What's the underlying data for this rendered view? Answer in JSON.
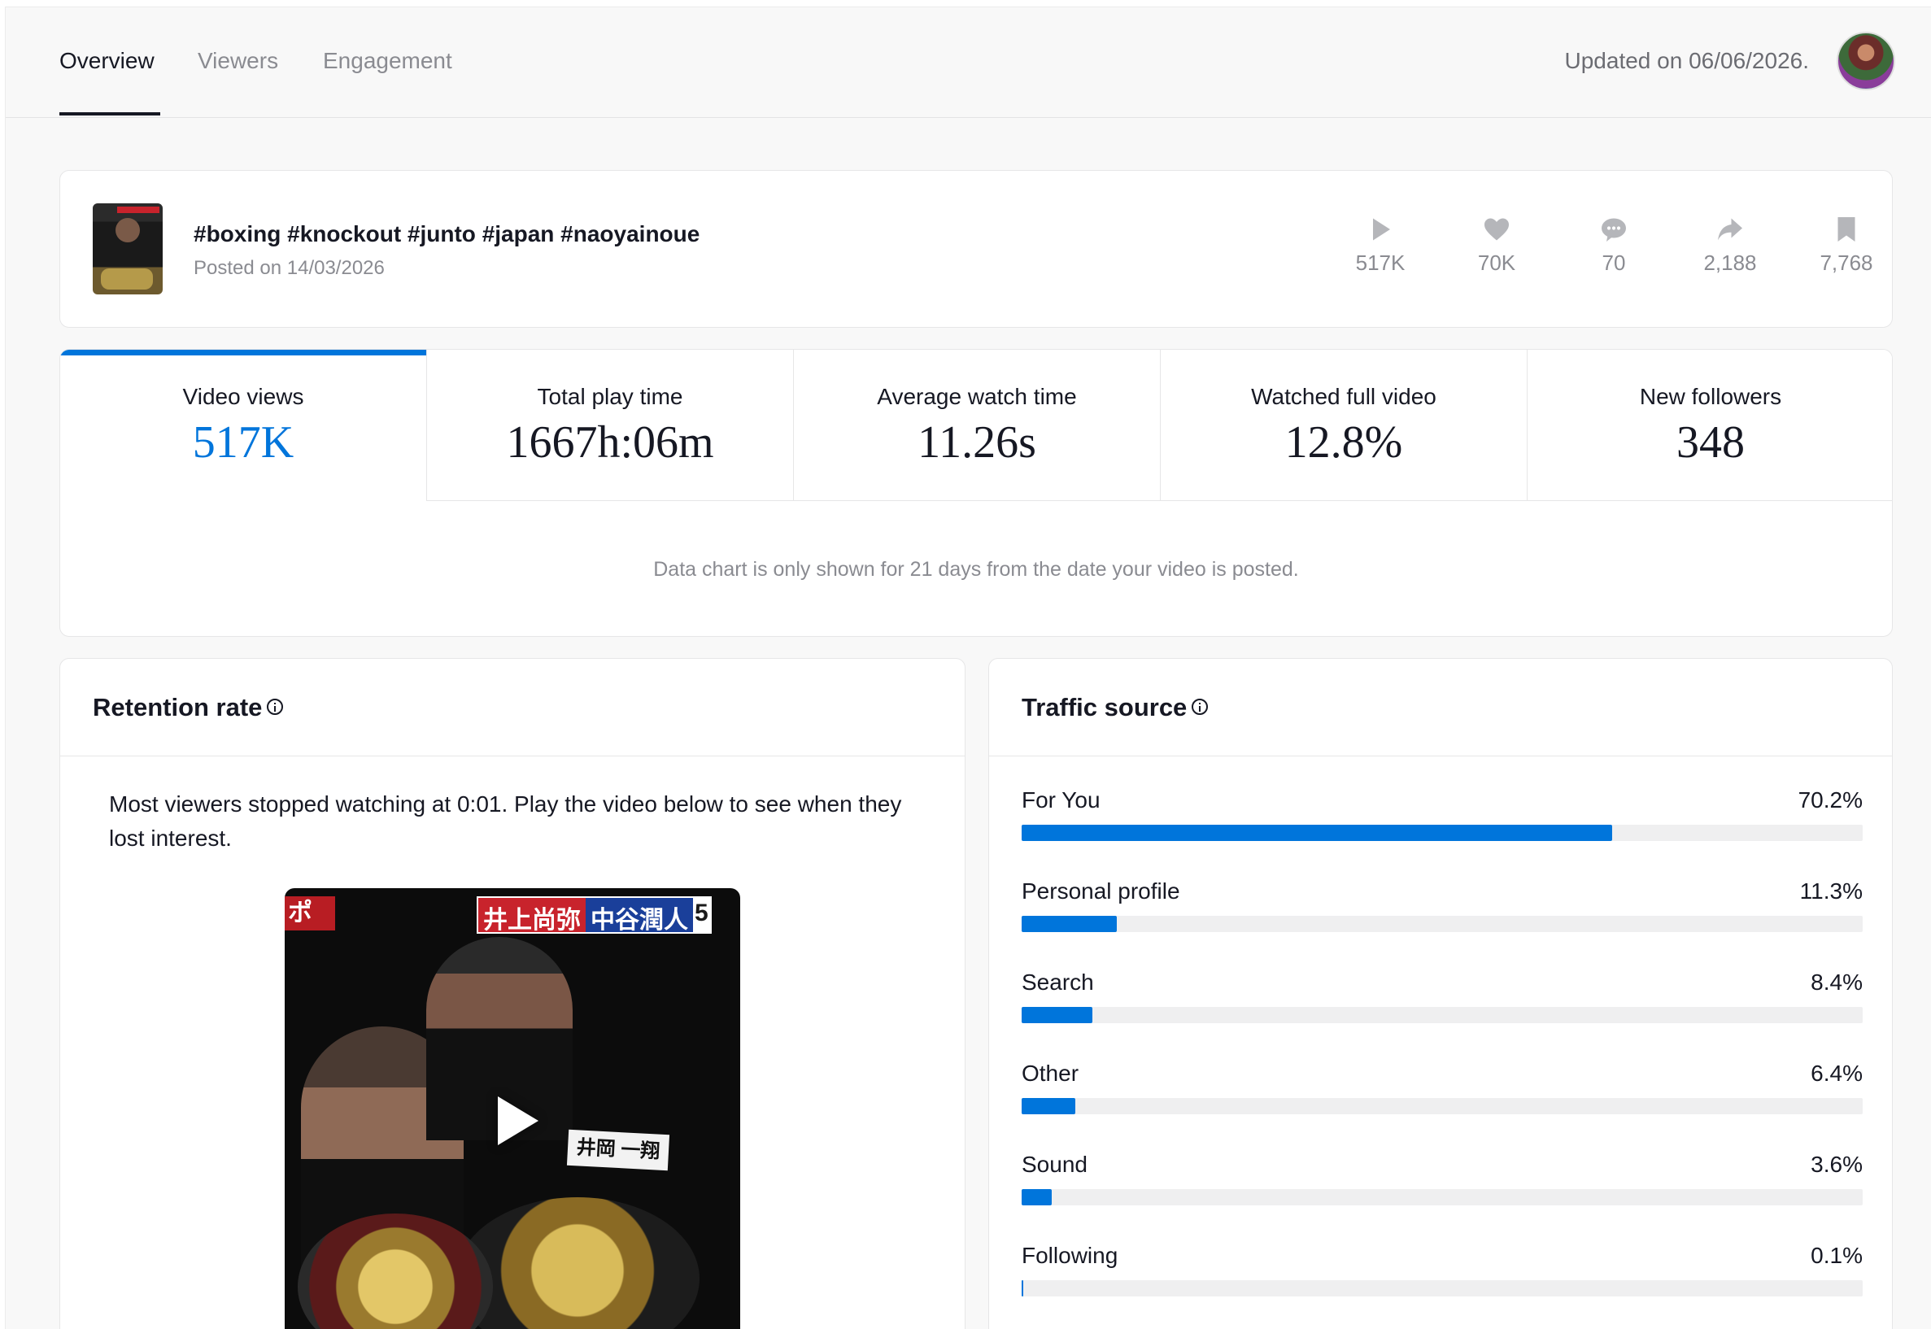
{
  "tabs": [
    {
      "label": "Overview",
      "active": true
    },
    {
      "label": "Viewers",
      "active": false
    },
    {
      "label": "Engagement",
      "active": false
    }
  ],
  "updated_text": "Updated on 06/06/2026.",
  "video": {
    "title": "#boxing #knockout #junto #japan #naoyainoue",
    "posted": "Posted on 14/03/2026",
    "stats": [
      {
        "icon": "play-icon",
        "value": "517K"
      },
      {
        "icon": "heart-icon",
        "value": "70K"
      },
      {
        "icon": "comment-icon",
        "value": "70"
      },
      {
        "icon": "share-icon",
        "value": "2,188"
      },
      {
        "icon": "bookmark-icon",
        "value": "7,768"
      }
    ]
  },
  "metrics": [
    {
      "label": "Video views",
      "value": "517K",
      "active": true
    },
    {
      "label": "Total play time",
      "value": "1667h:06m",
      "active": false
    },
    {
      "label": "Average watch time",
      "value": "11.26s",
      "active": false
    },
    {
      "label": "Watched full video",
      "value": "12.8%",
      "active": false
    },
    {
      "label": "New followers",
      "value": "348",
      "active": false
    }
  ],
  "chart_note": "Data chart is only shown for 21 days from the date your video is posted.",
  "retention": {
    "title": "Retention rate",
    "text": "Most viewers stopped watching at 0:01. Play the video below to see when they lost interest.",
    "overlay": {
      "left_tag": "ポ",
      "banner_red": "井上尚弥",
      "banner_blue": "中谷潤人",
      "banner_tail": "5",
      "name_card": "井岡 一翔"
    }
  },
  "traffic": {
    "title": "Traffic source",
    "accent": "#0075db",
    "sources": [
      {
        "name": "For You",
        "pct_label": "70.2%",
        "pct": 70.2
      },
      {
        "name": "Personal profile",
        "pct_label": "11.3%",
        "pct": 11.3
      },
      {
        "name": "Search",
        "pct_label": "8.4%",
        "pct": 8.4
      },
      {
        "name": "Other",
        "pct_label": "6.4%",
        "pct": 6.4
      },
      {
        "name": "Sound",
        "pct_label": "3.6%",
        "pct": 3.6
      },
      {
        "name": "Following",
        "pct_label": "0.1%",
        "pct": 0.1
      }
    ]
  }
}
